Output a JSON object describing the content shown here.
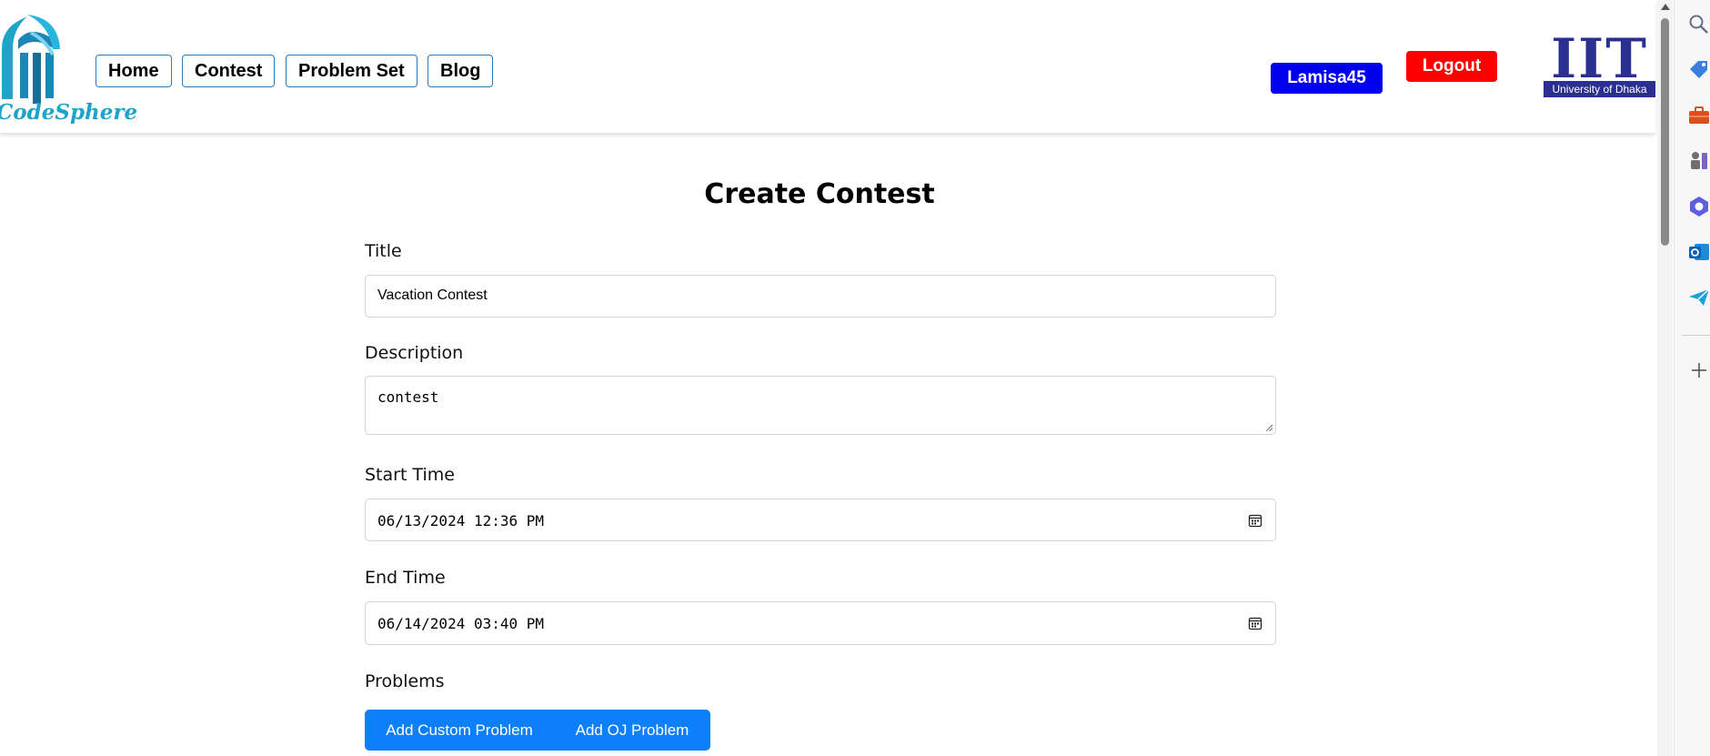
{
  "brand": {
    "name": "CodeSphere"
  },
  "nav": {
    "items": [
      {
        "label": "Home"
      },
      {
        "label": "Contest"
      },
      {
        "label": "Problem Set"
      },
      {
        "label": "Blog"
      }
    ]
  },
  "user": {
    "username": "Lamisa45",
    "logout_label": "Logout"
  },
  "institution": {
    "letters": "IIT",
    "subtitle": "University of Dhaka"
  },
  "page": {
    "title": "Create Contest"
  },
  "form": {
    "title_label": "Title",
    "title_value": "Vacation Contest",
    "description_label": "Description",
    "description_value": "contest",
    "start_label": "Start Time",
    "start_value": "06/13/2024 12:36 PM",
    "end_label": "End Time",
    "end_value": "06/14/2024 03:40 PM",
    "problems_label": "Problems",
    "add_custom_label": "Add Custom Problem",
    "add_oj_label": "Add OJ Problem"
  },
  "sidepanel": {
    "icons": [
      "search-icon",
      "tag-icon",
      "briefcase-icon",
      "chess-icon",
      "copilot-icon",
      "outlook-icon",
      "send-icon",
      "add-icon"
    ]
  },
  "colors": {
    "user_button": "#0000ee",
    "logout_button": "#ff0000",
    "primary_button": "#0d7ff9",
    "brand_teal": "#1ea3c9",
    "iit_blue": "#2b2f8f"
  }
}
